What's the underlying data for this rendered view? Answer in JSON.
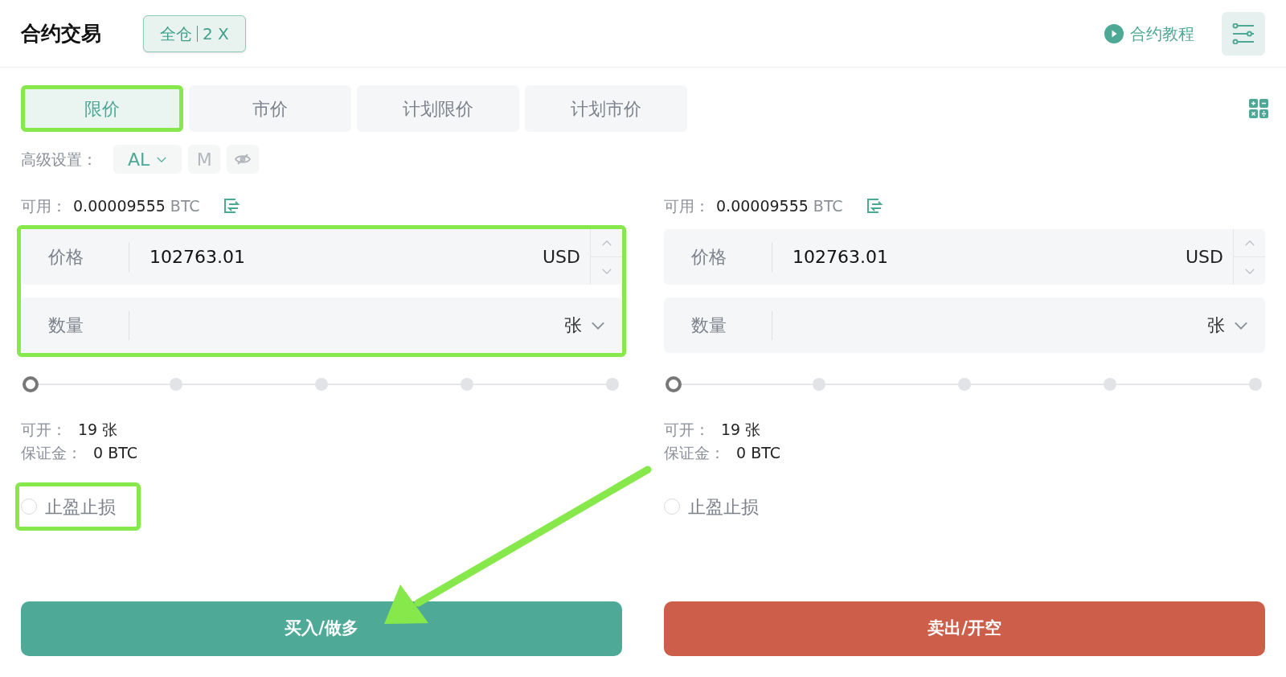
{
  "header": {
    "title": "合约交易",
    "margin_mode": "全仓",
    "leverage": "2 X",
    "tutorial": "合约教程"
  },
  "order_types": [
    {
      "label": "限价",
      "selected": true,
      "highlighted": true
    },
    {
      "label": "市价",
      "selected": false,
      "highlighted": false
    },
    {
      "label": "计划限价",
      "selected": false,
      "highlighted": false
    },
    {
      "label": "计划市价",
      "selected": false,
      "highlighted": false
    }
  ],
  "advanced": {
    "label": "高级设置：",
    "options": [
      {
        "kind": "dropdown",
        "label": "AL",
        "selected": true
      },
      {
        "kind": "text",
        "label": "M",
        "selected": false
      },
      {
        "kind": "eye",
        "selected": false
      }
    ]
  },
  "panels": [
    {
      "available_label": "可用：",
      "available_value": "0.00009555",
      "available_unit": "BTC",
      "form_highlighted": true,
      "price": {
        "label": "价格",
        "value": "102763.01",
        "unit": "USD"
      },
      "quantity": {
        "label": "数量",
        "unit": "张"
      },
      "slider": {
        "level": 0
      },
      "openable_label": "可开：",
      "openable_value": "19 张",
      "margin_label": "保证金：",
      "margin_value": "0 BTC",
      "tp_sl": {
        "label": "止盈止损",
        "checked": false,
        "highlighted": true
      },
      "submit": {
        "label": "买入/做多",
        "kind": "buy"
      }
    },
    {
      "available_label": "可用：",
      "available_value": "0.00009555",
      "available_unit": "BTC",
      "form_highlighted": false,
      "price": {
        "label": "价格",
        "value": "102763.01",
        "unit": "USD"
      },
      "quantity": {
        "label": "数量",
        "unit": "张"
      },
      "slider": {
        "level": 0
      },
      "openable_label": "可开：",
      "openable_value": "19 张",
      "margin_label": "保证金：",
      "margin_value": "0 BTC",
      "tp_sl": {
        "label": "止盈止损",
        "checked": false,
        "highlighted": false
      },
      "submit": {
        "label": "卖出/开空",
        "kind": "sell"
      }
    }
  ],
  "annotation_arrow": true
}
